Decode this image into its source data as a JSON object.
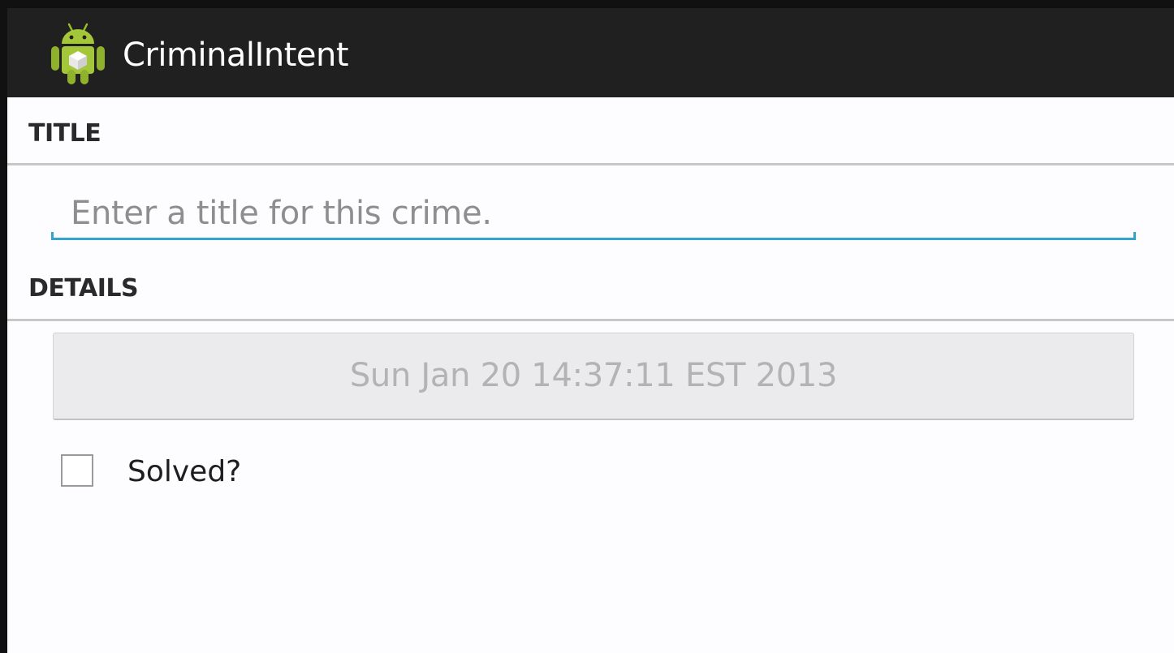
{
  "action_bar": {
    "app_title": "CriminalIntent",
    "icon": "android-robot-icon",
    "background_color": "#202020"
  },
  "title_section": {
    "header": "TITLE",
    "input": {
      "value": "",
      "placeholder": "Enter a title for this crime.",
      "accent_color": "#33a4cc"
    }
  },
  "details_section": {
    "header": "DETAILS",
    "date_button_label": "Sun Jan 20 14:37:11 EST 2013",
    "solved_checkbox": {
      "label": "Solved?",
      "checked": false
    }
  }
}
